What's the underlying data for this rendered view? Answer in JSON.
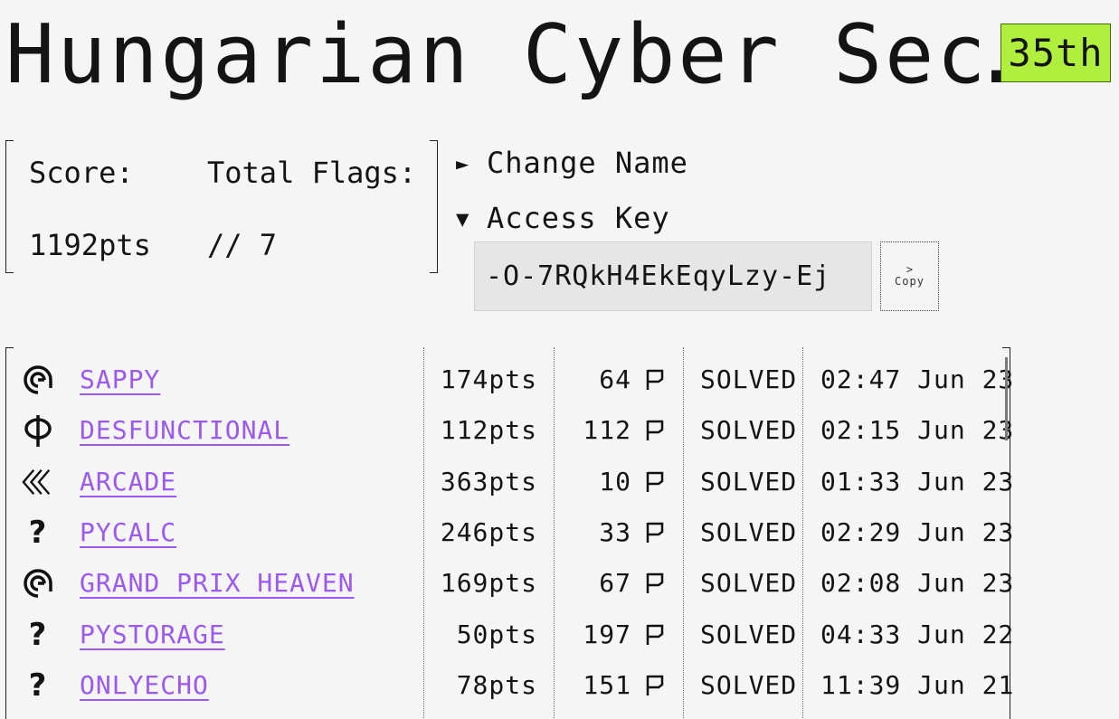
{
  "team": {
    "name": "Hungarian Cyber Sec…",
    "rank": "35th"
  },
  "stats": {
    "score_label": "Score:",
    "score_value": "1192pts",
    "flags_label": "Total Flags:",
    "flags_value": "// 7"
  },
  "details": {
    "change_name": {
      "arrow": "►",
      "label": "Change Name",
      "expanded": false
    },
    "access_key": {
      "arrow": "▼",
      "label": "Access Key",
      "expanded": true,
      "value": "-O-7RQkH4EkEqyLzy-Ej"
    },
    "copy_button": {
      "chevron": ">",
      "label": "Copy"
    }
  },
  "colors": {
    "rank_bg": "#b0ef3d",
    "link": "#9b59f0",
    "background": "#f5f5f5"
  },
  "solves": [
    {
      "icon": "spiral-icon",
      "name": "SAPPY",
      "points": "174pts",
      "solves": "64",
      "status": "SOLVED",
      "time": "02:47 Jun 23"
    },
    {
      "icon": "phi-icon",
      "name": "DESFUNCTIONAL",
      "points": "112pts",
      "solves": "112",
      "status": "SOLVED",
      "time": "02:15 Jun 23"
    },
    {
      "icon": "chevrons-left-icon",
      "name": "ARCADE",
      "points": "363pts",
      "solves": "10",
      "status": "SOLVED",
      "time": "01:33 Jun 23"
    },
    {
      "icon": "question-icon",
      "name": "PYCALC",
      "points": "246pts",
      "solves": "33",
      "status": "SOLVED",
      "time": "02:29 Jun 23"
    },
    {
      "icon": "spiral-icon",
      "name": "GRAND PRIX HEAVEN",
      "points": "169pts",
      "solves": "67",
      "status": "SOLVED",
      "time": "02:08 Jun 23"
    },
    {
      "icon": "question-icon",
      "name": "PYSTORAGE",
      "points": "50pts",
      "solves": "197",
      "status": "SOLVED",
      "time": "04:33 Jun 22"
    },
    {
      "icon": "question-icon",
      "name": "ONLYECHO",
      "points": "78pts",
      "solves": "151",
      "status": "SOLVED",
      "time": "11:39 Jun 21"
    }
  ]
}
